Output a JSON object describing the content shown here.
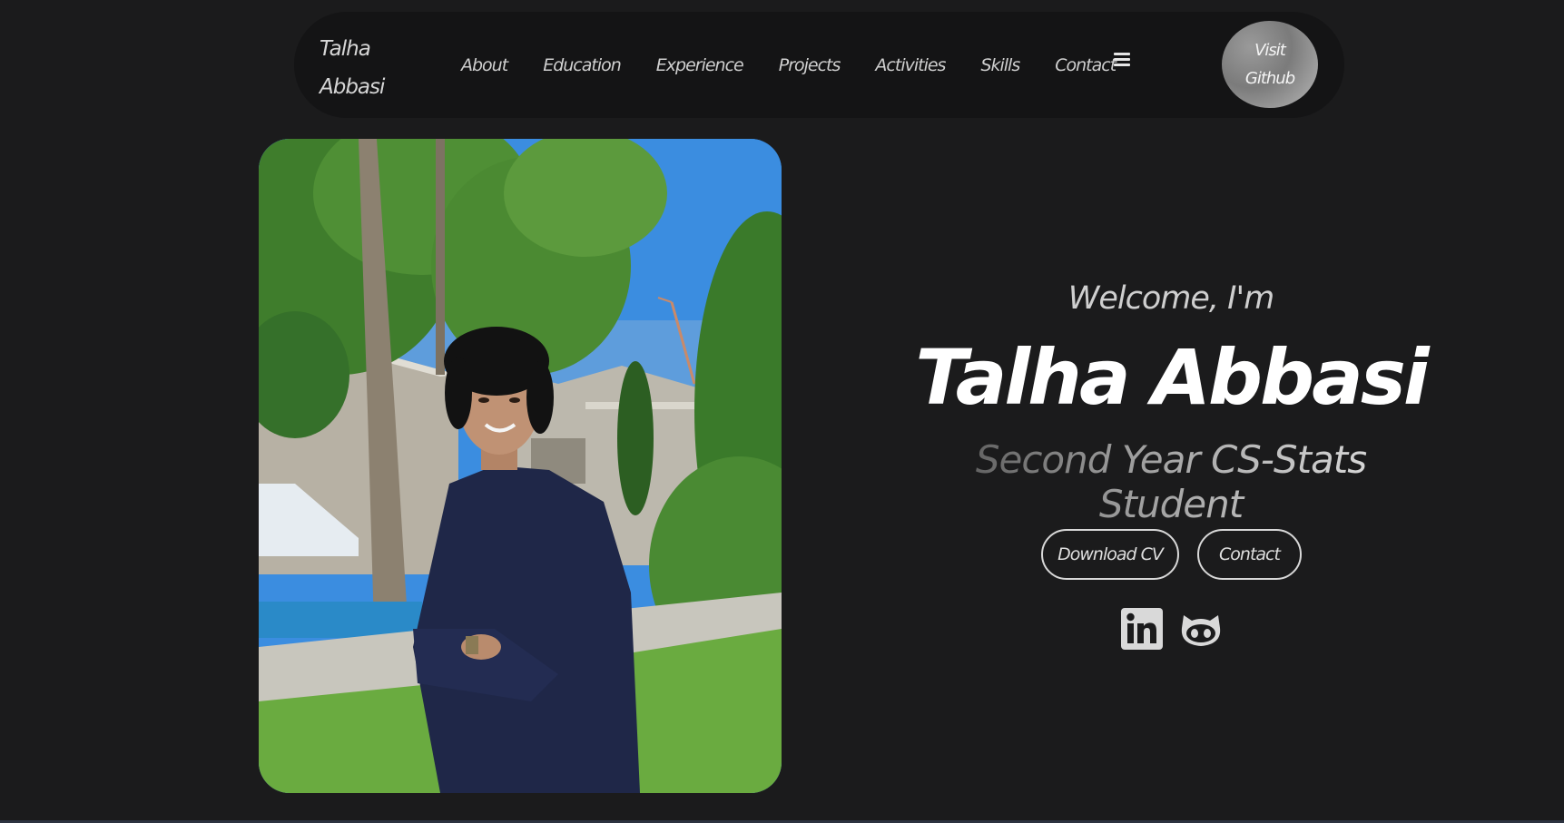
{
  "nav": {
    "logo_line1": "Talha",
    "logo_line2": "Abbasi",
    "items": [
      "About",
      "Education",
      "Experience",
      "Projects",
      "Activities",
      "Skills",
      "Contact"
    ],
    "github_line1": "Visit",
    "github_line2": "Github"
  },
  "hero": {
    "welcome": "Welcome, I'm",
    "name": "Talha Abbasi",
    "subtitle": "Second Year CS-Stats Student",
    "download_cv": "Download CV",
    "contact": "Contact"
  },
  "icons": {
    "hamburger": "menu-icon",
    "linkedin": "linkedin-icon",
    "github": "github-icon"
  },
  "colors": {
    "background": "#1b1b1c",
    "nav_background": "#141415",
    "accent_text": "#ffffff"
  }
}
